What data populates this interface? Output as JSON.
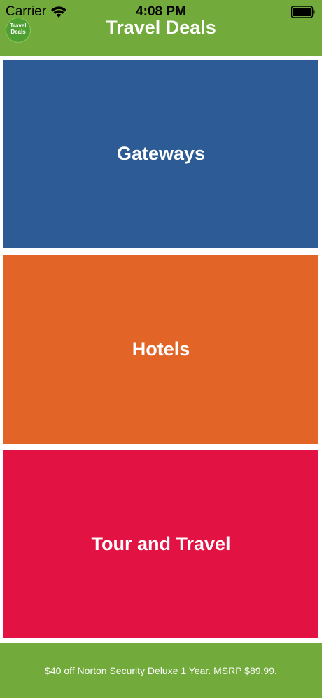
{
  "status_bar": {
    "carrier": "Carrier",
    "time": "4:08 PM",
    "wifi_icon": "wifi-icon",
    "battery_icon": "battery-icon"
  },
  "header": {
    "title": "Travel Deals",
    "logo_text_line1": "Travel",
    "logo_text_line2": "Deals",
    "background_color": "#72aa3c"
  },
  "categories": [
    {
      "label": "Gateways",
      "color": "#2d5b95"
    },
    {
      "label": "Hotels",
      "color": "#e26427"
    },
    {
      "label": "Tour and Travel",
      "color": "#e21243"
    }
  ],
  "footer": {
    "ad_text": "$40 off Norton Security Deluxe 1 Year. MSRP $89.99."
  }
}
